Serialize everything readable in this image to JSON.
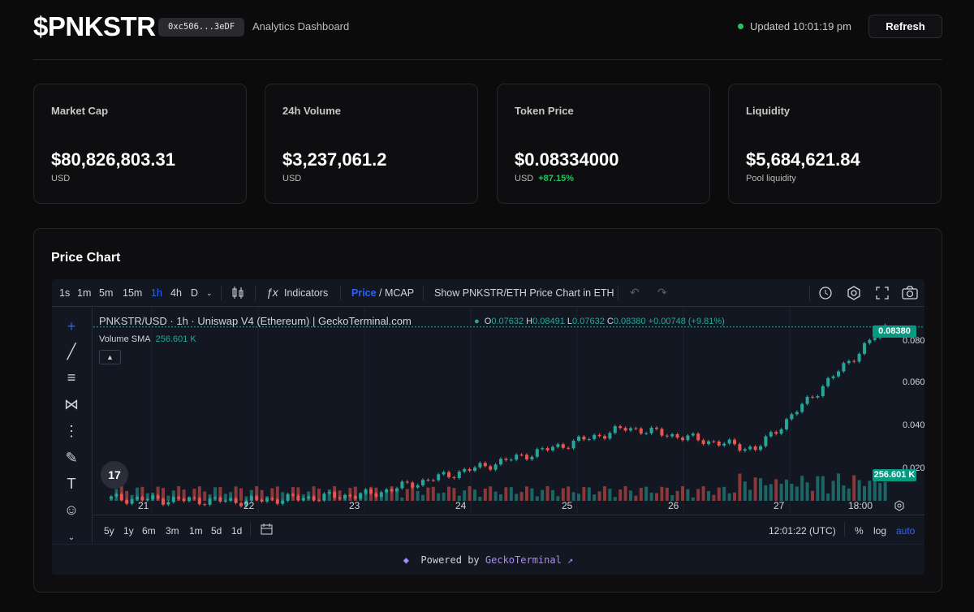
{
  "header": {
    "title": "$PNKSTR",
    "address": "0xc506...3eDF",
    "subtitle": "Analytics Dashboard",
    "updated": "Updated 10:01:19 pm",
    "refresh_label": "Refresh"
  },
  "cards": [
    {
      "label": "Market Cap",
      "value": "$80,826,803.31",
      "sub": "USD",
      "change": ""
    },
    {
      "label": "24h Volume",
      "value": "$3,237,061.2",
      "sub": "USD",
      "change": ""
    },
    {
      "label": "Token Price",
      "value": "$0.08334000",
      "sub": "USD",
      "change": "+87.15%"
    },
    {
      "label": "Liquidity",
      "value": "$5,684,621.84",
      "sub": "Pool liquidity",
      "change": ""
    }
  ],
  "chart_panel": {
    "title": "Price Chart",
    "toolbar": {
      "intervals": [
        "1s",
        "1m",
        "5m",
        "15m",
        "1h",
        "4h",
        "D"
      ],
      "active_interval": "1h",
      "indicators": "Indicators",
      "price": "Price",
      "mcap": "/ MCAP",
      "show_eth": "Show PNKSTR/ETH Price Chart in ETH"
    },
    "legend": {
      "symbol": "PNKSTR/USD · 1h · Uniswap V4 (Ethereum) | GeckoTerminal.com",
      "o": "0.07632",
      "h": "0.08491",
      "l": "0.07632",
      "c": "0.08380",
      "change": "+0.00748 (+9.81%)",
      "volume_label": "Volume SMA",
      "volume_value": "256.601 K"
    },
    "price_tag": "0.08380",
    "volume_tag": "256.601 K",
    "y_ticks": [
      "0.08000",
      "0.06000",
      "0.04000",
      "0.02000"
    ],
    "x_ticks": [
      "21",
      "22",
      "23",
      "24",
      "25",
      "26",
      "27",
      "18:00"
    ],
    "ranges": [
      "5y",
      "1y",
      "6m",
      "3m",
      "1m",
      "5d",
      "1d"
    ],
    "time": "12:01:22 (UTC)",
    "percent": "%",
    "log": "log",
    "auto": "auto",
    "powered_by": "Powered by",
    "gecko": "GeckoTerminal ↗"
  },
  "colors": {
    "up": "#26a69a",
    "down": "#ef5350",
    "accent": "#2962ff",
    "positive": "#22c55e"
  },
  "chart_data": {
    "type": "line",
    "title": "PNKSTR/USD · 1h · Uniswap V4 (Ethereum) | GeckoTerminal.com",
    "x": [
      "21",
      "22",
      "23",
      "24",
      "25",
      "26",
      "27"
    ],
    "ylim": [
      0.015,
      0.088
    ],
    "series": [
      {
        "name": "PNKSTR/USD",
        "values": [
          0.0195,
          0.0185,
          0.021,
          0.033,
          0.046,
          0.038,
          0.0838
        ]
      }
    ]
  }
}
